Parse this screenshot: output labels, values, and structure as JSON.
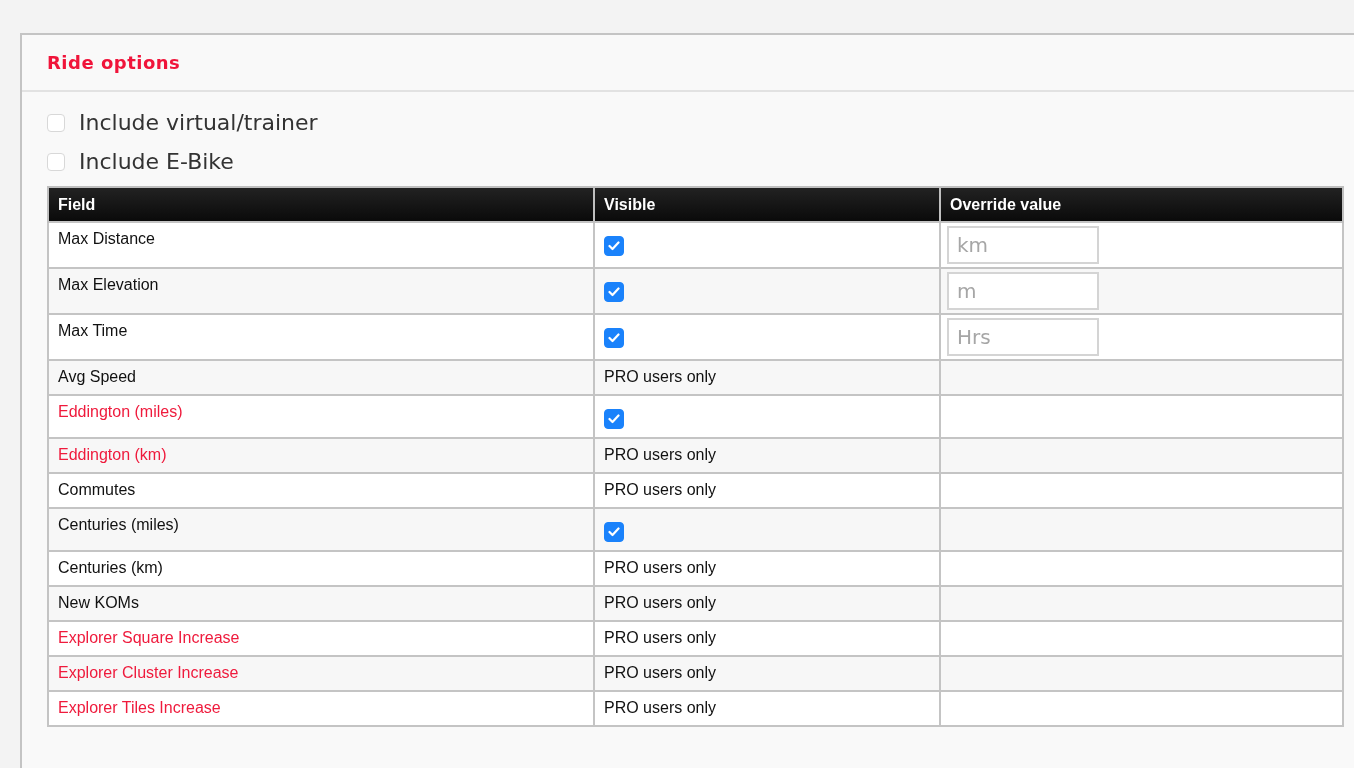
{
  "panel": {
    "title": "Ride options"
  },
  "options": [
    {
      "label": "Include virtual/trainer",
      "checked": false
    },
    {
      "label": "Include E-Bike",
      "checked": false
    }
  ],
  "table": {
    "columns": [
      "Field",
      "Visible",
      "Override value"
    ],
    "rows": [
      {
        "field": "Max Distance",
        "highlighted": false,
        "visible": {
          "kind": "checkbox",
          "checked": true
        },
        "override": {
          "placeholder": "km"
        }
      },
      {
        "field": "Max Elevation",
        "highlighted": false,
        "visible": {
          "kind": "checkbox",
          "checked": true
        },
        "override": {
          "placeholder": "m"
        }
      },
      {
        "field": "Max Time",
        "highlighted": false,
        "visible": {
          "kind": "checkbox",
          "checked": true
        },
        "override": {
          "placeholder": "Hrs"
        }
      },
      {
        "field": "Avg Speed",
        "highlighted": false,
        "visible": {
          "kind": "text",
          "text": "PRO users only"
        }
      },
      {
        "field": "Eddington (miles)",
        "highlighted": true,
        "visible": {
          "kind": "checkbox",
          "checked": true
        }
      },
      {
        "field": "Eddington (km)",
        "highlighted": true,
        "visible": {
          "kind": "text",
          "text": "PRO users only"
        }
      },
      {
        "field": "Commutes",
        "highlighted": false,
        "visible": {
          "kind": "text",
          "text": "PRO users only"
        }
      },
      {
        "field": "Centuries (miles)",
        "highlighted": false,
        "visible": {
          "kind": "checkbox",
          "checked": true
        }
      },
      {
        "field": "Centuries (km)",
        "highlighted": false,
        "visible": {
          "kind": "text",
          "text": "PRO users only"
        }
      },
      {
        "field": "New KOMs",
        "highlighted": false,
        "visible": {
          "kind": "text",
          "text": "PRO users only"
        }
      },
      {
        "field": "Explorer Square Increase",
        "highlighted": true,
        "visible": {
          "kind": "text",
          "text": "PRO users only"
        }
      },
      {
        "field": "Explorer Cluster Increase",
        "highlighted": true,
        "visible": {
          "kind": "text",
          "text": "PRO users only"
        }
      },
      {
        "field": "Explorer Tiles Increase",
        "highlighted": true,
        "visible": {
          "kind": "text",
          "text": "PRO users only"
        }
      }
    ]
  }
}
